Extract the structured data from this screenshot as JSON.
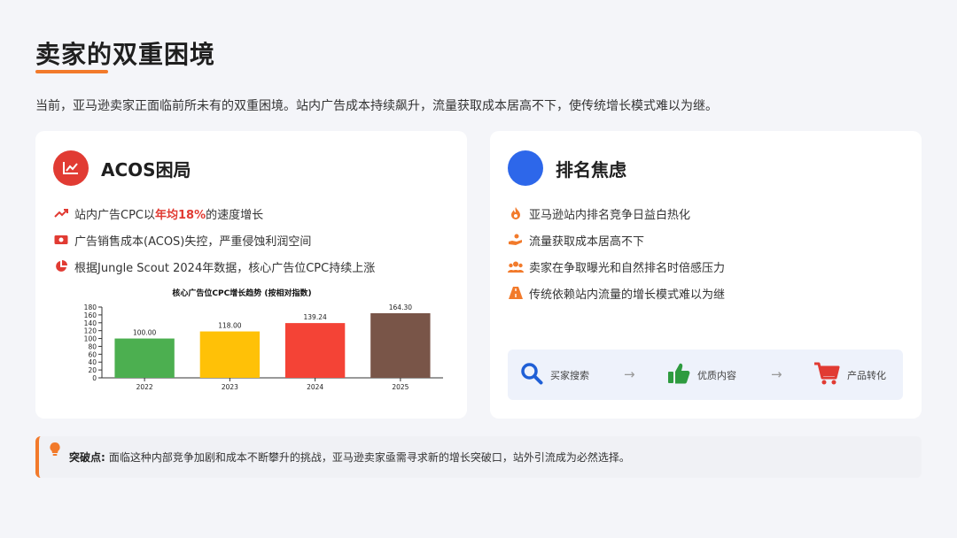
{
  "page": {
    "title": "卖家的双重困境",
    "intro": "当前，亚马逊卖家正面临前所未有的双重困境。站内广告成本持续飙升，流量获取成本居高不下，使传统增长模式难以为继。"
  },
  "acos_card": {
    "title": "ACOS困局",
    "icon": "chart-line-icon",
    "accent_color": "#e13b33",
    "bullets": [
      {
        "icon": "trend-up-icon",
        "prefix": "站内广告CPC以",
        "highlight": "年均18%",
        "suffix": "的速度增长"
      },
      {
        "icon": "money-icon",
        "text": "广告销售成本(ACOS)失控，严重侵蚀利润空间"
      },
      {
        "icon": "pie-chart-icon",
        "text": "根据Jungle Scout 2024年数据，核心广告位CPC持续上涨"
      }
    ]
  },
  "ranking_card": {
    "title": "排名焦虑",
    "accent_color": "#2d67ea",
    "bullets": [
      {
        "icon": "fire-icon",
        "text": "亚马逊站内排名竞争日益白热化"
      },
      {
        "icon": "hand-coin-icon",
        "text": "流量获取成本居高不下"
      },
      {
        "icon": "users-icon",
        "text": "卖家在争取曝光和自然排名时倍感压力"
      },
      {
        "icon": "road-icon",
        "text": "传统依赖站内流量的增长模式难以为继"
      }
    ],
    "flow": [
      {
        "icon": "search-icon",
        "label": "买家搜索"
      },
      {
        "icon": "thumbs-up-icon",
        "label": "优质内容"
      },
      {
        "icon": "cart-icon",
        "label": "产品转化"
      }
    ],
    "flow_arrow": "→"
  },
  "chart_data": {
    "type": "bar",
    "title": "核心广告位CPC增长趋势 (按相对指数)",
    "categories": [
      "2022",
      "2023",
      "2024",
      "2025"
    ],
    "values": [
      100.0,
      118.0,
      139.24,
      164.3
    ],
    "value_labels": [
      "100.00",
      "118.00",
      "139.24",
      "164.30"
    ],
    "colors": [
      "#4caf50",
      "#ffc107",
      "#f44336",
      "#795548"
    ],
    "ylim": [
      0,
      180
    ],
    "yticks": [
      0,
      20,
      40,
      60,
      80,
      100,
      120,
      140,
      160,
      180
    ],
    "xlabel": "",
    "ylabel": "",
    "grid": false
  },
  "callout": {
    "icon": "lightbulb-icon",
    "label": "突破点:",
    "text": "面临这种内部竞争加剧和成本不断攀升的挑战，亚马逊卖家亟需寻求新的增长突破口，站外引流成为必然选择。"
  }
}
